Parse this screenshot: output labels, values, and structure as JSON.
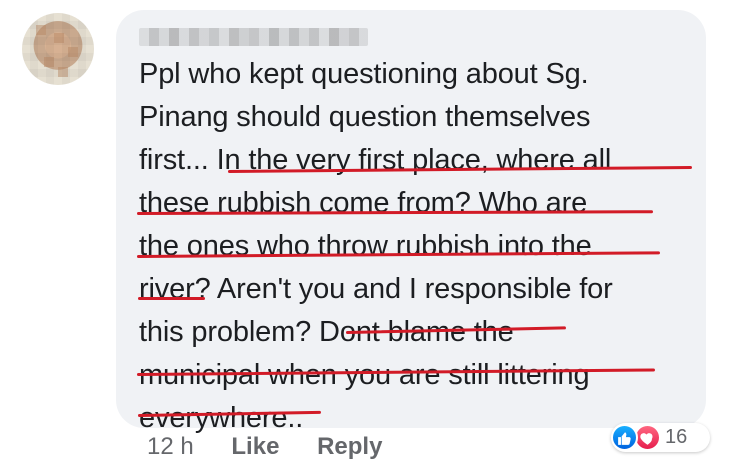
{
  "comment": {
    "lines": [
      "Ppl who kept questioning about Sg.",
      "Pinang should question themselves",
      "first... In the very first place, where all",
      "these rubbish come from? Who are",
      "the ones who throw rubbish into the",
      "river? Aren't you and I responsible for",
      "this problem? Dont blame the",
      "municipal when you are still littering",
      "everywhere.."
    ]
  },
  "meta": {
    "time": "12 h",
    "like_label": "Like",
    "reply_label": "Reply"
  },
  "reactions": {
    "count": "16",
    "icons": [
      "thumbs-up-icon",
      "heart-icon"
    ],
    "colors": {
      "like": "#1877f2",
      "love": "#f33e58",
      "underline": "#d21b27"
    }
  }
}
